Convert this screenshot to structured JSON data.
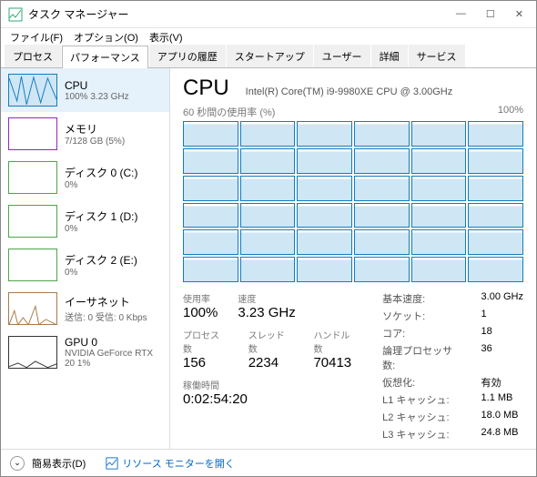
{
  "window": {
    "title": "タスク マネージャー"
  },
  "winButtons": {
    "min": "—",
    "max": "☐",
    "close": "✕"
  },
  "menus": [
    "ファイル(F)",
    "オプション(O)",
    "表示(V)"
  ],
  "tabs": [
    "プロセス",
    "パフォーマンス",
    "アプリの履歴",
    "スタートアップ",
    "ユーザー",
    "詳細",
    "サービス"
  ],
  "activeTab": 1,
  "sidebar": [
    {
      "title": "CPU",
      "sub": "100%  3.23 GHz",
      "kind": "cpu",
      "sel": true
    },
    {
      "title": "メモリ",
      "sub": "7/128 GB (5%)",
      "kind": "mem"
    },
    {
      "title": "ディスク 0 (C:)",
      "sub": "0%",
      "kind": "disk"
    },
    {
      "title": "ディスク 1 (D:)",
      "sub": "0%",
      "kind": "disk"
    },
    {
      "title": "ディスク 2 (E:)",
      "sub": "0%",
      "kind": "disk"
    },
    {
      "title": "イーサネット",
      "sub": "送信: 0  受信: 0 Kbps",
      "kind": "net"
    },
    {
      "title": "GPU 0",
      "sub": "NVIDIA GeForce RTX 20\n1%",
      "kind": "gpu"
    }
  ],
  "main": {
    "heading": "CPU",
    "model": "Intel(R) Core(TM) i9-9980XE CPU @ 3.00GHz",
    "chartLeft": "60 秒間の使用率 (%)",
    "chartRight": "100%",
    "coreCount": 36
  },
  "stats": {
    "row1": [
      {
        "label": "使用率",
        "val": "100%"
      },
      {
        "label": "速度",
        "val": "3.23 GHz"
      }
    ],
    "row2": [
      {
        "label": "プロセス数",
        "val": "156"
      },
      {
        "label": "スレッド数",
        "val": "2234"
      },
      {
        "label": "ハンドル数",
        "val": "70413"
      }
    ],
    "uptime": {
      "label": "稼働時間",
      "val": "0:02:54:20"
    }
  },
  "spec": [
    [
      "基本速度:",
      "3.00 GHz"
    ],
    [
      "ソケット:",
      "1"
    ],
    [
      "コア:",
      "18"
    ],
    [
      "論理プロセッサ数:",
      "36"
    ],
    [
      "仮想化:",
      "有効"
    ],
    [
      "L1 キャッシュ:",
      "1.1 MB"
    ],
    [
      "L2 キャッシュ:",
      "18.0 MB"
    ],
    [
      "L3 キャッシュ:",
      "24.8 MB"
    ]
  ],
  "footer": {
    "less": "簡易表示(D)",
    "monitor": "リソース モニターを開く"
  }
}
